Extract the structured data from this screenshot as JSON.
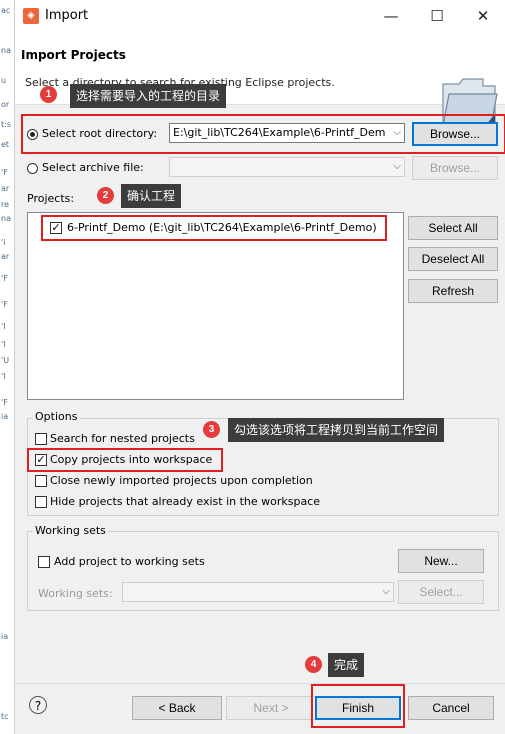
{
  "window": {
    "title": "Import",
    "min_label": "—",
    "max_label": "☐",
    "close_label": "✕"
  },
  "header": {
    "title": "Import Projects",
    "description": "Select a directory to search for existing Eclipse projects."
  },
  "root_dir": {
    "label": "Select root directory:",
    "value": "E:\\git_lib\\TC264\\Example\\6-Printf_Dem",
    "browse": "Browse..."
  },
  "archive": {
    "label": "Select archive file:",
    "value": "",
    "browse": "Browse..."
  },
  "projects": {
    "label": "Projects:",
    "items": [
      {
        "label": "6-Printf_Demo (E:\\git_lib\\TC264\\Example\\6-Printf_Demo)",
        "checked": true
      }
    ],
    "select_all": "Select All",
    "deselect_all": "Deselect All",
    "refresh": "Refresh"
  },
  "options": {
    "title": "Options",
    "search_nested": "Search for nested projects",
    "copy_projects": "Copy projects into workspace",
    "close_newly": "Close newly imported projects upon completion",
    "hide_existing": "Hide projects that already exist in the workspace"
  },
  "working_sets": {
    "title": "Working sets",
    "add_label": "Add project to working sets",
    "new_button": "New...",
    "sets_label": "Working sets:",
    "select_button": "Select..."
  },
  "footer": {
    "help": "?",
    "back": "< Back",
    "next": "Next >",
    "finish": "Finish",
    "cancel": "Cancel"
  },
  "annotations": [
    {
      "number": "1",
      "text": "选择需要导入的工程的目录"
    },
    {
      "number": "2",
      "text": "确认工程"
    },
    {
      "number": "3",
      "text": "勾选该选项将工程拷贝到当前工作空间"
    },
    {
      "number": "4",
      "text": "完成"
    }
  ],
  "left_strip": [
    "ac",
    "na",
    "u",
    "or",
    "t:s",
    "et",
    "'F",
    "ar",
    "re",
    "na",
    "'i",
    "ar",
    "'F",
    "'F",
    "'I",
    "'I",
    "'U",
    "'I",
    "'F",
    "ia",
    "ia",
    "tc"
  ],
  "colors": {
    "annotation_red": "#e02020",
    "badge_red": "#e43c3c",
    "tooltip_bg": "#3c3c3c",
    "app_icon": "#e9673b",
    "focus_blue": "#0078d7"
  }
}
